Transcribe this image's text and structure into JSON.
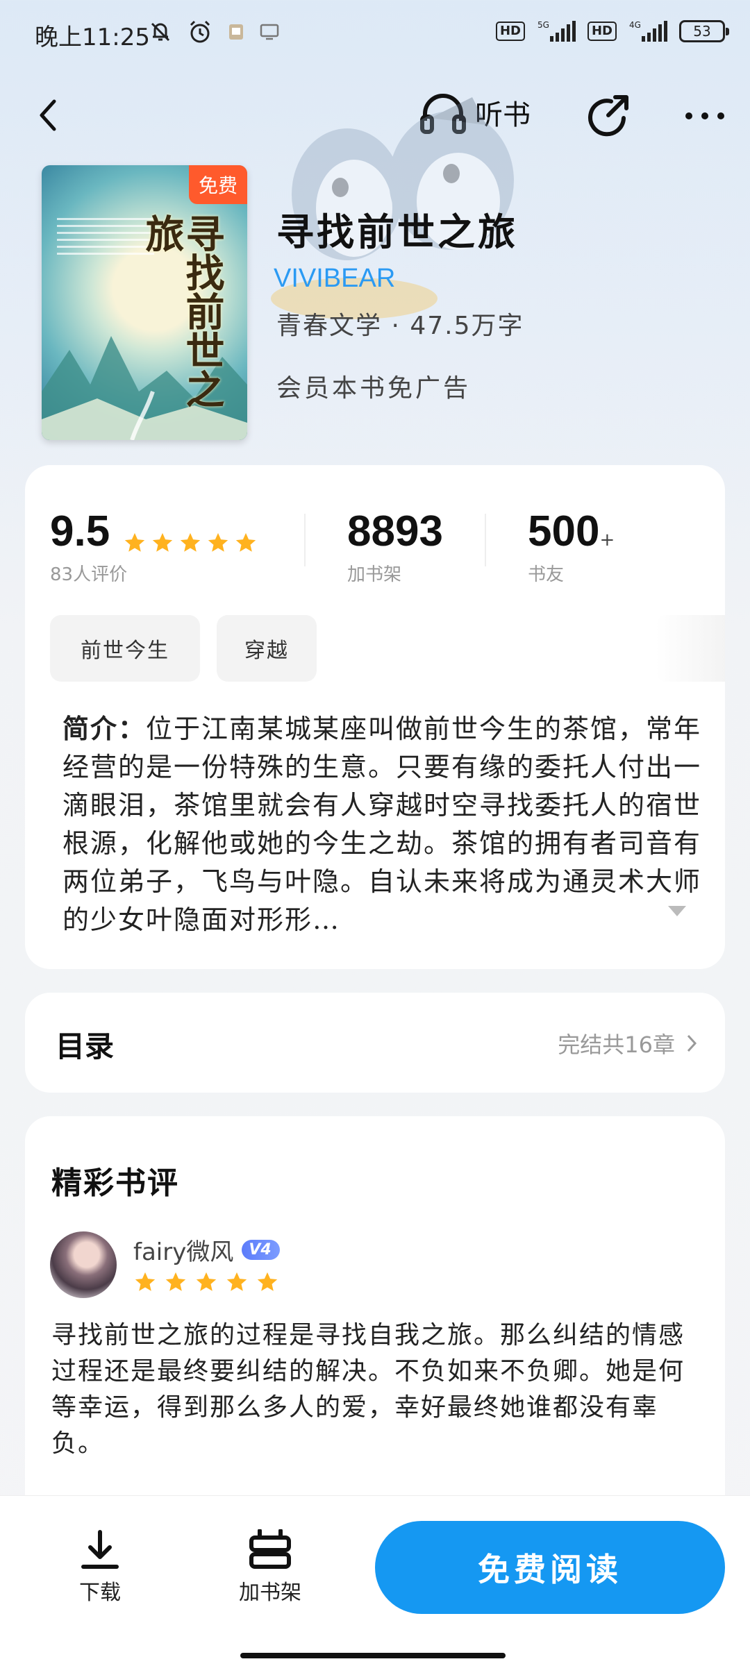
{
  "status_bar": {
    "time": "晚上11:25",
    "network1": "5G",
    "network2": "4G",
    "hd": "HD",
    "battery": "53"
  },
  "header": {
    "listen_label": "听书"
  },
  "book": {
    "cover_badge": "免费",
    "cover_title": "寻找前世之旅",
    "title": "寻找前世之旅",
    "author": "VIVIBEAR",
    "meta": "青春文学 · 47.5万字",
    "vip_note": "会员本书免广告"
  },
  "stats": {
    "rating": "9.5",
    "rating_stars": 5,
    "rating_label": "83人评价",
    "shelf_count": "8893",
    "shelf_label": "加书架",
    "friends_count": "500",
    "friends_plus": "+",
    "friends_label": "书友"
  },
  "tags": [
    "前世今生",
    "穿越"
  ],
  "intro": {
    "label": "简介：",
    "text": "位于江南某城某座叫做前世今生的茶馆，常年经营的是一份特殊的生意。只要有缘的委托人付出一滴眼泪，茶馆里就会有人穿越时空寻找委托人的宿世根源，化解他或她的今生之劫。茶馆的拥有者司音有两位弟子，飞鸟与叶隐。自认未来将成为通灵术大师的少女叶隐面对形形…"
  },
  "toc": {
    "title": "目录",
    "summary": "完结共16章"
  },
  "reviews": {
    "title": "精彩书评",
    "items": [
      {
        "user": "fairy微风",
        "badge": "V4",
        "stars": 5,
        "text": "寻找前世之旅的过程是寻找自我之旅。那么纠结的情感过程还是最终要纠结的解决。不负如来不负卿。她是何等幸运，得到那么多人的爱，幸好最终她谁都没有辜负。"
      }
    ]
  },
  "bottom_bar": {
    "download_label": "下载",
    "shelf_label": "加书架",
    "read_label": "免费阅读"
  },
  "colors": {
    "accent": "#1598f2",
    "author": "#2b9af3",
    "star": "#ffb21f",
    "badge_free": "#ff5a2c"
  }
}
